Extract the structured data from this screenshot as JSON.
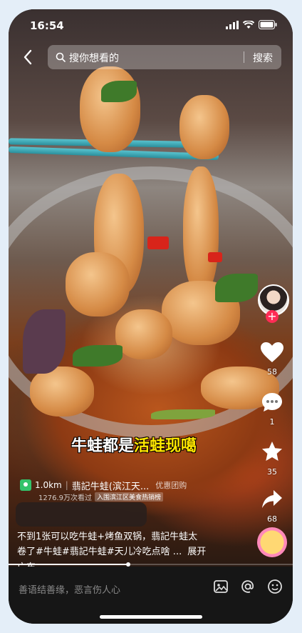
{
  "status_bar": {
    "time": "16:54"
  },
  "search": {
    "placeholder": "搜你想看的",
    "button_label": "搜索"
  },
  "video": {
    "caption_overlay": {
      "part1": "牛蛙都是",
      "part2": "活蛙现噶"
    }
  },
  "sidebar": {
    "likes": "58",
    "comments": "1",
    "favorites": "35",
    "shares": "68"
  },
  "poi": {
    "distance": "1.0km",
    "name": "翡記牛蛙(滨江天...",
    "deal_label": "优惠团购",
    "views": "1276.9万次看过",
    "rank_badge": "入围滨江区美食热销榜"
  },
  "description": {
    "line1": "不到1张可以吃牛蛙+烤鱼双锅，翡記牛蛙太",
    "line2": "卷了#牛蛙#翡記牛蛙#天儿冷吃点啥 ...",
    "expand_label": "展开",
    "line3": "广东"
  },
  "progress": {
    "fraction": 0.42
  },
  "bottom_bar": {
    "comment_placeholder": "善语结善缘，恶言伤人心"
  },
  "colors": {
    "follow_red": "#fe2c55",
    "poi_green": "#33c36b",
    "caption_yellow": "#ffe600"
  }
}
